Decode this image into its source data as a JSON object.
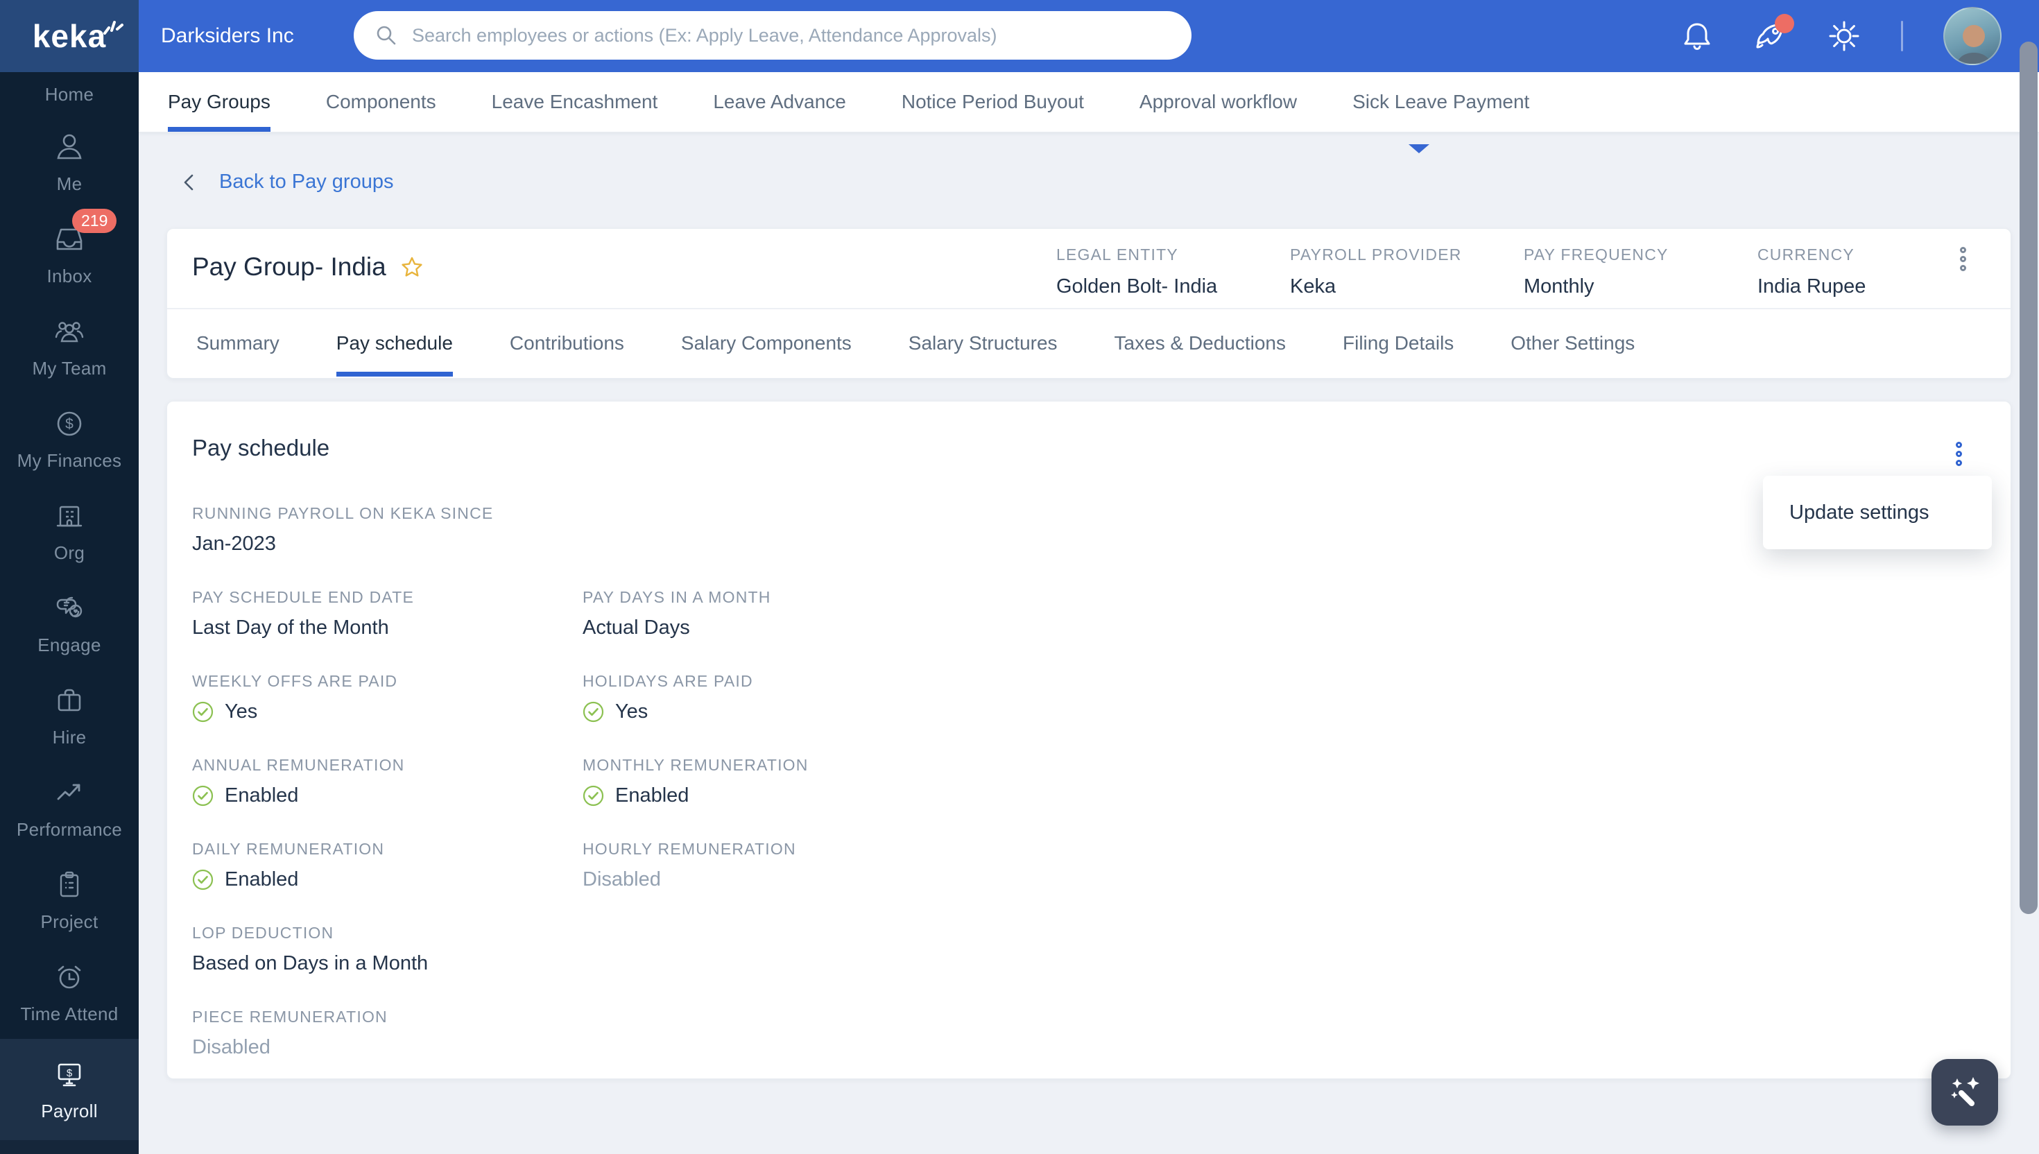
{
  "header": {
    "brand": "keka",
    "company": "Darksiders Inc",
    "search_placeholder": "Search employees or actions (Ex: Apply Leave, Attendance Approvals)"
  },
  "sidebar": {
    "items": [
      {
        "label": "Home",
        "icon": "home-icon"
      },
      {
        "label": "Me",
        "icon": "me-icon"
      },
      {
        "label": "Inbox",
        "icon": "inbox-icon",
        "badge": "219"
      },
      {
        "label": "My Team",
        "icon": "team-icon"
      },
      {
        "label": "My Finances",
        "icon": "finances-icon"
      },
      {
        "label": "Org",
        "icon": "org-icon"
      },
      {
        "label": "Engage",
        "icon": "engage-icon"
      },
      {
        "label": "Hire",
        "icon": "hire-icon"
      },
      {
        "label": "Performance",
        "icon": "performance-icon"
      },
      {
        "label": "Project",
        "icon": "project-icon"
      },
      {
        "label": "Time Attend",
        "icon": "time-attend-icon"
      },
      {
        "label": "Payroll",
        "icon": "payroll-icon",
        "active": true
      }
    ]
  },
  "module_tabs": {
    "active": "Pay Groups",
    "items": [
      "Pay Groups",
      "Components",
      "Leave Encashment",
      "Leave Advance",
      "Notice Period Buyout",
      "Approval workflow",
      "Sick Leave Payment"
    ]
  },
  "breadcrumb": {
    "back_label": "Back to Pay groups"
  },
  "pay_group": {
    "title": "Pay Group- India",
    "meta": [
      {
        "label": "LEGAL ENTITY",
        "value": "Golden Bolt- India"
      },
      {
        "label": "PAYROLL PROVIDER",
        "value": "Keka"
      },
      {
        "label": "PAY FREQUENCY",
        "value": "Monthly"
      },
      {
        "label": "CURRENCY",
        "value": "India Rupee"
      }
    ],
    "tabs": {
      "active": "Pay schedule",
      "items": [
        "Summary",
        "Pay schedule",
        "Contributions",
        "Salary Components",
        "Salary Structures",
        "Taxes & Deductions",
        "Filing Details",
        "Other Settings"
      ]
    }
  },
  "pay_schedule": {
    "heading": "Pay schedule",
    "rows": [
      [
        {
          "label": "RUNNING PAYROLL ON KEKA SINCE",
          "value": "Jan-2023",
          "type": "plain"
        }
      ],
      [
        {
          "label": "PAY SCHEDULE END DATE",
          "value": "Last Day of the Month",
          "type": "plain"
        },
        {
          "label": "PAY DAYS IN A MONTH",
          "value": "Actual Days",
          "type": "plain"
        }
      ],
      [
        {
          "label": "WEEKLY OFFS ARE PAID",
          "value": "Yes",
          "type": "check"
        },
        {
          "label": "HOLIDAYS ARE PAID",
          "value": "Yes",
          "type": "check"
        }
      ],
      [
        {
          "label": "ANNUAL REMUNERATION",
          "value": "Enabled",
          "type": "check"
        },
        {
          "label": "MONTHLY REMUNERATION",
          "value": "Enabled",
          "type": "check"
        }
      ],
      [
        {
          "label": "DAILY REMUNERATION",
          "value": "Enabled",
          "type": "check"
        },
        {
          "label": "HOURLY REMUNERATION",
          "value": "Disabled",
          "type": "muted"
        }
      ],
      [
        {
          "label": "LOP DEDUCTION",
          "value": "Based on Days in a Month",
          "type": "plain"
        }
      ],
      [
        {
          "label": "PIECE REMUNERATION",
          "value": "Disabled",
          "type": "muted"
        }
      ]
    ]
  },
  "context_menu": {
    "items": [
      "Update settings"
    ]
  },
  "colors": {
    "header_blue": "#3767d2",
    "logo_navy": "#27497b",
    "sidebar_navy": "#0e2033",
    "sidebar_active": "#1e3148",
    "accent_blue": "#3064d2",
    "link_blue": "#3a75d4",
    "badge_red": "#ed6d64",
    "check_green": "#8cc152",
    "fab_slate": "#3b4458",
    "page_bg": "#eef1f6"
  }
}
